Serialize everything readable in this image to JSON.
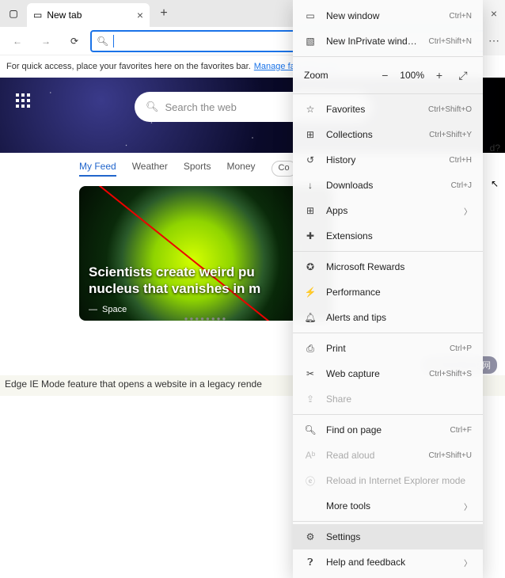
{
  "tab": {
    "title": "New tab"
  },
  "favbar": {
    "text": "For quick access, place your favorites here on the favorites bar.",
    "link": "Manage favorites now"
  },
  "search": {
    "placeholder": "Search the web"
  },
  "feed": {
    "tabs": [
      "My Feed",
      "Weather",
      "Sports",
      "Money"
    ],
    "pill": "Co",
    "headline": "Scientists create weird pu\nnucleus that vanishes in m",
    "source": "Space"
  },
  "menu": {
    "new_window": "New window",
    "new_inprivate": "New InPrivate window",
    "zoom": "Zoom",
    "zoom_pct": "100%",
    "favorites": "Favorites",
    "collections": "Collections",
    "history": "History",
    "downloads": "Downloads",
    "apps": "Apps",
    "extensions": "Extensions",
    "rewards": "Microsoft Rewards",
    "performance": "Performance",
    "alerts": "Alerts and tips",
    "print": "Print",
    "webcapture": "Web capture",
    "share": "Share",
    "find": "Find on page",
    "readaloud": "Read aloud",
    "iemode": "Reload in Internet Explorer mode",
    "moretools": "More tools",
    "settings": "Settings",
    "help": "Help and feedback",
    "kbd": {
      "new_window": "Ctrl+N",
      "new_inprivate": "Ctrl+Shift+N",
      "favorites": "Ctrl+Shift+O",
      "collections": "Ctrl+Shift+Y",
      "history": "Ctrl+H",
      "downloads": "Ctrl+J",
      "print": "Ctrl+P",
      "webcapture": "Ctrl+Shift+S",
      "find": "Ctrl+F",
      "readaloud": "Ctrl+Shift+U"
    }
  },
  "caption": "Edge IE Mode feature that opens a website in a legacy rende",
  "watermark": "php 中文网",
  "right_hint": "d?"
}
